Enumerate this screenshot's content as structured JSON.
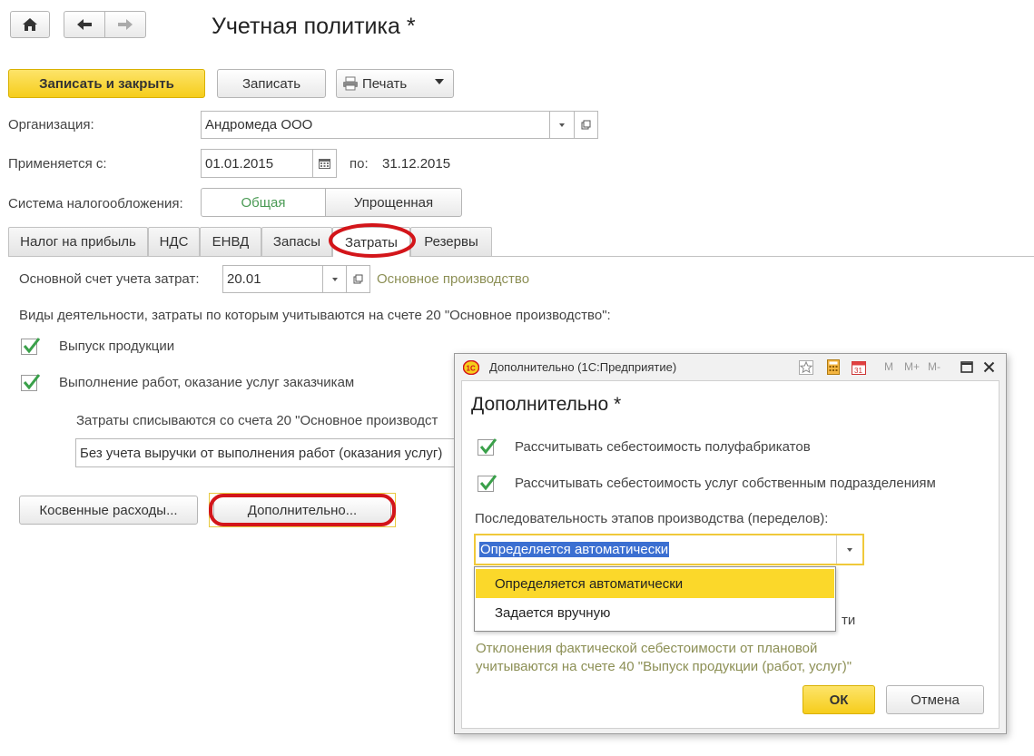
{
  "nav": {
    "home_icon": "home-icon",
    "back_icon": "arrow-left-icon",
    "forward_icon": "arrow-right-icon"
  },
  "header": {
    "title": "Учетная политика *"
  },
  "toolbar": {
    "save_close": "Записать и закрыть",
    "save": "Записать",
    "print": "Печать"
  },
  "form": {
    "org_label": "Организация:",
    "org_value": "Андромеда ООО",
    "applies_label": "Применяется с:",
    "applies_value": "01.01.2015",
    "to_label": "по:",
    "to_value": "31.12.2015",
    "tax_label": "Система налогообложения:",
    "tax_options": [
      "Общая",
      "Упрощенная"
    ]
  },
  "tabs": [
    "Налог на прибыль",
    "НДС",
    "ЕНВД",
    "Запасы",
    "Затраты",
    "Резервы"
  ],
  "costs": {
    "account_label": "Основной счет учета затрат:",
    "account_value": "20.01",
    "account_name": "Основное производство",
    "activities_text": "Виды деятельности, затраты по которым учитываются на счете 20 \"Основное производство\":",
    "check1": "Выпуск продукции",
    "check2": "Выполнение работ, оказание услуг заказчикам",
    "writeoff_text": "Затраты списываются со счета 20 \"Основное производст",
    "writeoff_value": "Без учета выручки от выполнения работ (оказания услуг)",
    "indirect_btn": "Косвенные расходы...",
    "extra_btn": "Дополнительно..."
  },
  "dialog": {
    "window_title": "Дополнительно (1С:Предприятие)",
    "title": "Дополнительно *",
    "check1": "Рассчитывать себестоимость полуфабрикатов",
    "check2": "Рассчитывать себестоимость услуг собственным подразделениям",
    "seq_label": "Последовательность этапов производства (переделов):",
    "seq_value": "Определяется автоматически",
    "dropdown_options": [
      "Определяется автоматически",
      "Задается вручную"
    ],
    "hidden_tail": "ти",
    "note_line1": "Отклонения фактической себестоимости от плановой",
    "note_line2": "учитываются на счете 40 \"Выпуск продукции (работ, услуг)\"",
    "ok": "ОК",
    "cancel": "Отмена",
    "ctrl_m": "M",
    "ctrl_mplus": "M+",
    "ctrl_mminus": "M-"
  },
  "colors": {
    "accent_yellow": "#f6cd1b",
    "highlight": "#fbd82a",
    "annotation_red": "#d3151a",
    "green_text": "#4a9a54"
  }
}
